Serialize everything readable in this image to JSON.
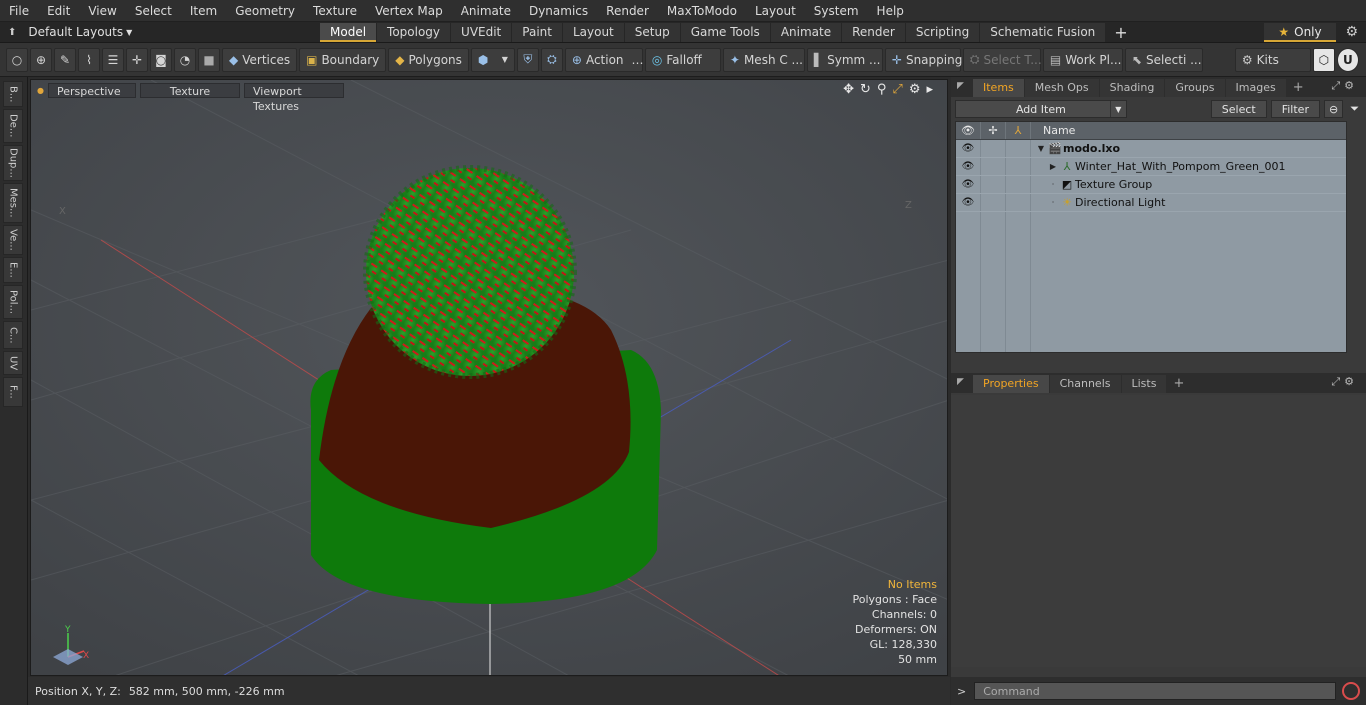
{
  "menu": [
    "File",
    "Edit",
    "View",
    "Select",
    "Item",
    "Geometry",
    "Texture",
    "Vertex Map",
    "Animate",
    "Dynamics",
    "Render",
    "MaxToModo",
    "Layout",
    "System",
    "Help"
  ],
  "layouts": {
    "label": "Default Layouts"
  },
  "mode_tabs": [
    {
      "label": "Model",
      "active": true
    },
    {
      "label": "Topology"
    },
    {
      "label": "UVEdit"
    },
    {
      "label": "Paint"
    },
    {
      "label": "Layout"
    },
    {
      "label": "Setup"
    },
    {
      "label": "Game Tools"
    },
    {
      "label": "Animate"
    },
    {
      "label": "Render"
    },
    {
      "label": "Scripting"
    },
    {
      "label": "Schematic Fusion"
    }
  ],
  "only_label": "Only",
  "toolbar": {
    "vertices": "Vertices",
    "boundary": "Boundary",
    "polygons": "Polygons",
    "action": "Action",
    "falloff": "Falloff",
    "mesh": "Mesh C ...",
    "symm": "Symm ...",
    "snapping": "Snapping",
    "select_t": "Select T...",
    "work_pl": "Work Pl...",
    "selecti": "Selecti ...",
    "kits": "Kits"
  },
  "left_tabs": [
    "B...",
    "De...",
    "Dup...",
    "Mes...",
    "Ve...",
    "E...",
    "Pol...",
    "C...",
    "UV",
    "F..."
  ],
  "viewport": {
    "perspective": "Perspective",
    "texture": "Texture",
    "viewport_textures": "Viewport Textures",
    "stats": {
      "no_items": "No Items",
      "polygons": "Polygons : Face",
      "channels": "Channels: 0",
      "deformers": "Deformers: ON",
      "gl": "GL: 128,330",
      "scale": "50 mm"
    },
    "axis_x": "X",
    "axis_y": "Y",
    "axis_x_far": "X",
    "axis_z_far": "Z",
    "colors": {
      "hat_green": "#0e7a0b",
      "hat_brown": "#4a1606",
      "pompom_green": "#1e8f1e",
      "pompom_red": "#d01a1a",
      "bg": "#4a4d52"
    }
  },
  "status": {
    "label": "Position X, Y, Z:",
    "value": "582 mm, 500 mm, -226 mm"
  },
  "items_panel": {
    "tabs": [
      {
        "label": "Items",
        "active": true
      },
      {
        "label": "Mesh Ops"
      },
      {
        "label": "Shading"
      },
      {
        "label": "Groups"
      },
      {
        "label": "Images"
      }
    ],
    "add_item": "Add Item",
    "select": "Select",
    "filter": "Filter",
    "column_name": "Name",
    "rows": [
      {
        "name": "modo.lxo",
        "icon": "scene-icon",
        "bold": true
      },
      {
        "name": "Winter_Hat_With_Pompom_Green_001",
        "icon": "mesh-item-icon"
      },
      {
        "name": "Texture Group",
        "icon": "texture-group-icon"
      },
      {
        "name": "Directional Light",
        "icon": "light-icon"
      }
    ]
  },
  "props_panel": {
    "tabs": [
      {
        "label": "Properties",
        "active": true
      },
      {
        "label": "Channels"
      },
      {
        "label": "Lists"
      }
    ]
  },
  "command": {
    "placeholder": "Command"
  }
}
